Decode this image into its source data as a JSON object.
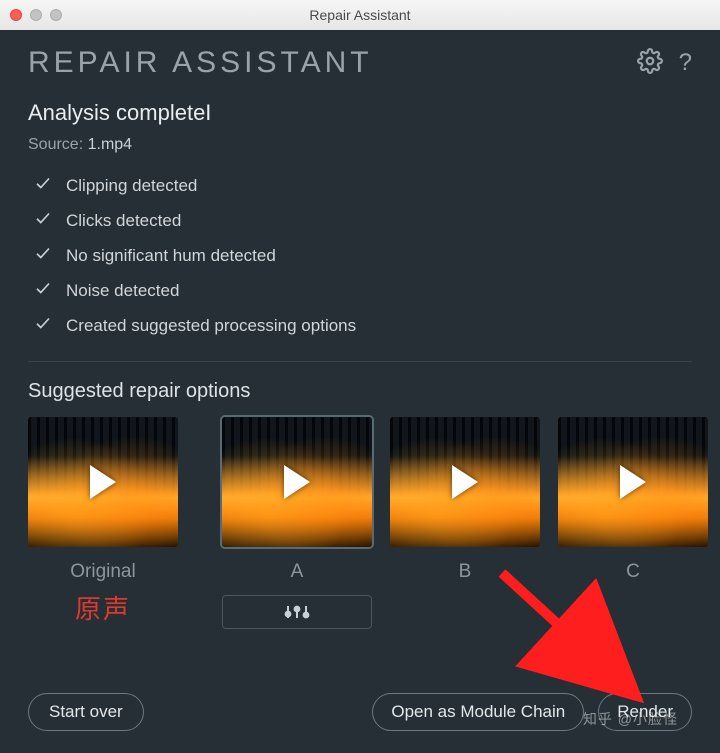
{
  "titlebar": {
    "title": "Repair Assistant"
  },
  "header": {
    "title": "REPAIR ASSISTANT"
  },
  "analysis": {
    "title": "Analysis completeI",
    "source_label": "Source:",
    "source_value": "1.mp4",
    "checks": [
      "Clipping detected",
      "Clicks detected",
      "No significant hum detected",
      "Noise detected",
      "Created suggested processing options"
    ]
  },
  "suggest": {
    "title": "Suggested repair options",
    "original_label": "Original",
    "original_cn": "原声",
    "options": [
      {
        "label": "A",
        "selected": true
      },
      {
        "label": "B",
        "selected": false
      },
      {
        "label": "C",
        "selected": false
      }
    ]
  },
  "footer": {
    "start_over": "Start over",
    "open_chain": "Open as Module Chain",
    "render": "Render"
  },
  "watermark": "知乎 @小脸怪"
}
